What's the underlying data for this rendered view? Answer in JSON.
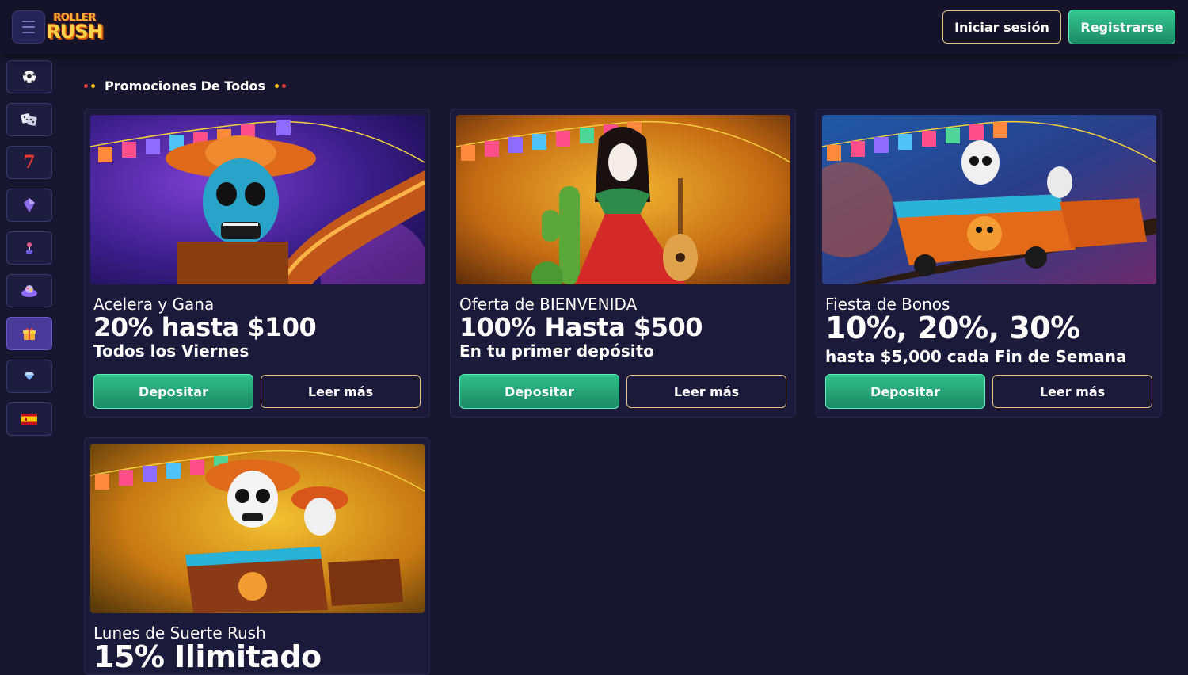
{
  "header": {
    "logo_line1": "ROLLER",
    "logo_line2": "RUSH",
    "login_label": "Iniciar sesión",
    "register_label": "Registrarse"
  },
  "sidebar": {
    "items": [
      {
        "name": "sidebar-item-sports",
        "icon": "⚽"
      },
      {
        "name": "sidebar-item-live-casino",
        "icon": "🎲"
      },
      {
        "name": "sidebar-item-slots",
        "icon": "7"
      },
      {
        "name": "sidebar-item-crypto",
        "icon": "◆"
      },
      {
        "name": "sidebar-item-games",
        "icon": "🕹"
      },
      {
        "name": "sidebar-item-lottery",
        "icon": "🎱"
      },
      {
        "name": "sidebar-item-promotions",
        "icon": "🎁"
      },
      {
        "name": "sidebar-item-vip",
        "icon": "💎"
      },
      {
        "name": "sidebar-item-language",
        "icon": "es-flag"
      }
    ]
  },
  "section": {
    "title": "Promociones De Todos"
  },
  "promotions": [
    {
      "subtitle": "Acelera y Gana",
      "headline": "20% hasta $100",
      "detail": "Todos los Viernes",
      "deposit_label": "Depositar",
      "more_label": "Leer más"
    },
    {
      "subtitle": "Oferta de BIENVENIDA",
      "headline": "100% Hasta $500",
      "detail": "En tu primer depósito",
      "deposit_label": "Depositar",
      "more_label": "Leer más"
    },
    {
      "subtitle": "Fiesta de Bonos",
      "headline": "10%, 20%, 30%",
      "detail": "hasta $5,000 cada Fin de Semana",
      "deposit_label": "Depositar",
      "more_label": "Leer más"
    },
    {
      "subtitle": "Lunes de Suerte Rush",
      "headline": "15% Ilimitado"
    }
  ],
  "colors": {
    "background": "#17162e",
    "accent_green": "#2fbf8a",
    "accent_gold": "#e8c27a"
  }
}
